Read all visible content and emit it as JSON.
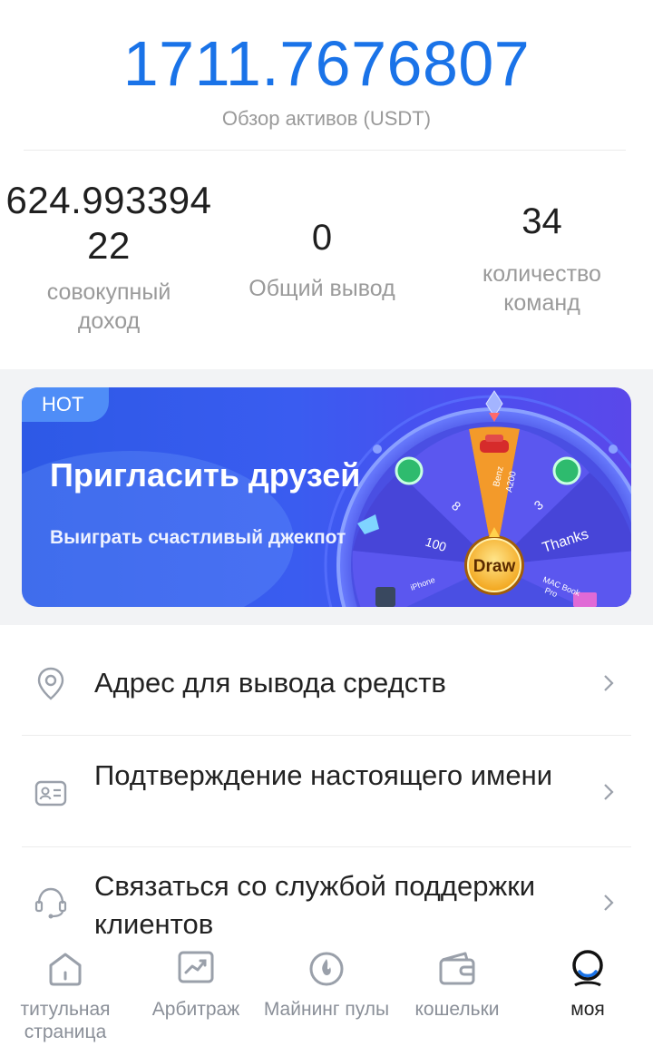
{
  "summary": {
    "total_assets": "1711.7676807",
    "total_assets_label": "Обзор активов (USDT)"
  },
  "stats": {
    "income_value": "624.99339422",
    "income_label": "совокупный доход",
    "withdraw_value": "0",
    "withdraw_label": "Общий вывод",
    "team_value": "34",
    "team_label": "количество команд"
  },
  "banner": {
    "tag": "HOT",
    "title": "Пригласить друзей",
    "subtitle": "Выиграть счастливый джекпот",
    "wheel": {
      "center_button": "Draw",
      "segments": [
        "Benz A200",
        "3",
        "Thanks",
        "MAC Book Pro",
        "iPhone",
        "100",
        "8"
      ]
    }
  },
  "menu": {
    "items": [
      {
        "label": "Адрес для вывода средств",
        "icon": "location-pin-icon"
      },
      {
        "label": "Подтверждение настоящего имени",
        "icon": "id-card-icon"
      },
      {
        "label": "Связаться со службой поддержки клиентов",
        "icon": "headset-icon"
      }
    ]
  },
  "tabbar": {
    "items": [
      {
        "label": "титульная страница",
        "icon": "home-icon",
        "active": false
      },
      {
        "label": "Арбитраж",
        "icon": "trend-chart-icon",
        "active": false
      },
      {
        "label": "Майнинг пулы",
        "icon": "flame-icon",
        "active": false
      },
      {
        "label": "кошельки",
        "icon": "wallet-icon",
        "active": false
      },
      {
        "label": "моя",
        "icon": "profile-icon",
        "active": true
      }
    ]
  },
  "colors": {
    "accent": "#1a73e8",
    "banner_start": "#2d59e6",
    "banner_end": "#5a48ea",
    "wheel_gold": "#f5a623",
    "muted_text": "#9a9a9a"
  }
}
